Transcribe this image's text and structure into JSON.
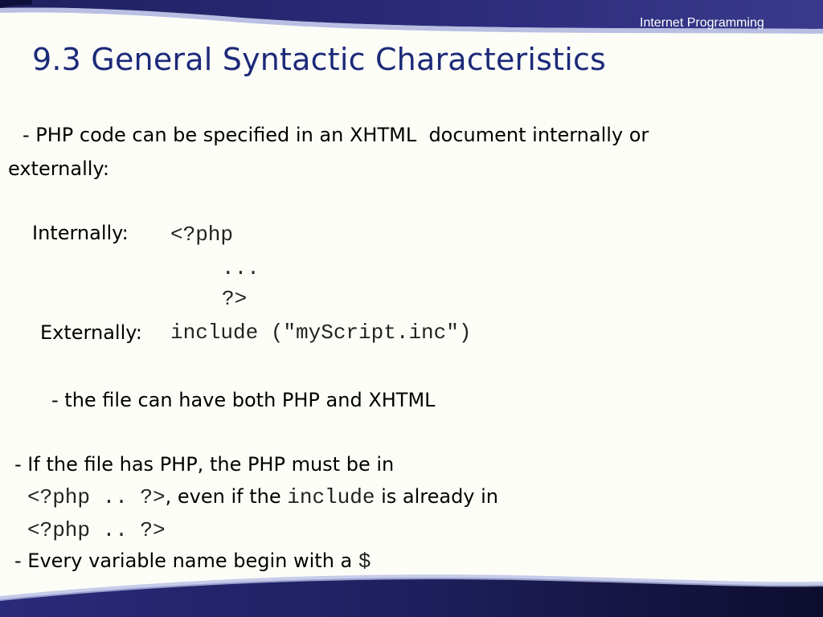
{
  "slide": {
    "brand": "Internet Programming",
    "title": "9.3 General Syntactic Characteristics",
    "colors": {
      "title": "#1c2a78",
      "header_band": "#2b2a78",
      "footer_band": "#2b2a78"
    },
    "intro": {
      "line1": "- PHP code can be specified in an XHTML  document internally or",
      "line2": "externally:"
    },
    "internally": {
      "label": "Internally:",
      "code_open": "<?php",
      "code_dots": "...",
      "code_close": "?>"
    },
    "externally": {
      "label": "Externally:",
      "code": "include (\"myScript.inc\")"
    },
    "note_file": "- the file can have both PHP and XHTML",
    "rule_php": {
      "line1": "- If the file has PHP, the PHP must be in",
      "code1": "<?php .. ?>",
      "text_even": ", even if the ",
      "code_include": "include",
      "text_already": " is already in",
      "code2": "<?php .. ?>"
    },
    "rule_variable": {
      "text": "- Every variable name begin with a ",
      "code": "$"
    }
  }
}
